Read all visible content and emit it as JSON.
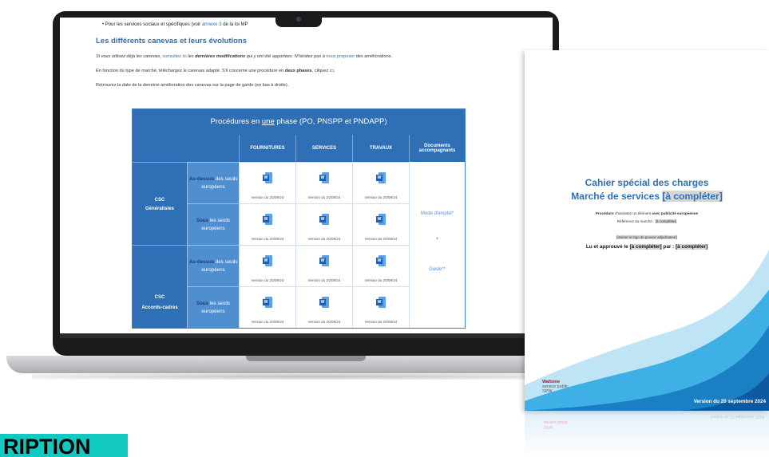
{
  "screen": {
    "bullet": {
      "prefix": "• Pour les services sociaux et spécifiques (voir ",
      "link": "annexe 3",
      "suffix": " de la loi MP"
    },
    "section_title": "Les différents canevas et leurs évolutions",
    "p1": {
      "a": "Si vous utilisez déjà les canevas, ",
      "link1": "consultez ici",
      "b": " les ",
      "bold": "dernières modifications",
      "c": " qui y ont été apportées. N'hésitez pas à ",
      "link2": "nous proposer",
      "d": " des améliorations."
    },
    "p2": {
      "a": "En fonction du type de marché, téléchargez le canevas adapté. S'il concerne une procédure en ",
      "bold": "deux phases",
      "b": ", cliquez ",
      "link": "ici",
      "c": "."
    },
    "p3": "Retrouvez la date de la dernière amélioration des canevas sur la page de garde (en bas à droite).",
    "table": {
      "title_a": "Procédures en ",
      "title_u": "une",
      "title_b": " phase (PO, PNSPP et PNDAPP)",
      "columns": [
        "FOURNITURES",
        "SERVICES",
        "TRAVAUX",
        "Documents accompagnants"
      ],
      "groups": [
        "CSC Généralistes",
        "CSC Accords-cadres"
      ],
      "group_line1": [
        "CSC",
        "CSC"
      ],
      "group_line2": [
        "Généralistes",
        "Accords-cadres"
      ],
      "rows": [
        {
          "strong": "Au-dessus",
          "rest": " des seuils européens"
        },
        {
          "strong": "Sous",
          "rest": " les seuils européens"
        },
        {
          "strong": "Au-dessus",
          "rest": " des seuils européens"
        },
        {
          "strong": "Sous",
          "rest": " les seuils européens"
        }
      ],
      "version_label": "Version du 20/09/24",
      "icon_letter": "W",
      "docs": [
        "Mode d'emploi*",
        "+",
        "Guide**"
      ]
    }
  },
  "document": {
    "title_line1": "Cahier spécial des charges",
    "title_line2_a": "Marché de services ",
    "title_line2_hl": "[à compléter]",
    "procedure_a": "Procédure",
    "procedure_b": " choisissez un élément ",
    "procedure_c": "avec publicité européenne",
    "reference_a": "Référence du marché : ",
    "reference_hl": "[à compléter]",
    "logo_line": "[Insérer le logo du pouvoir adjudicateur]",
    "approved_a": "Lu et approuvé le ",
    "approved_hl1": "[à compléter]",
    "approved_b": " par : ",
    "approved_hl2": "[à compléter]",
    "brand_line1": "Wallonie",
    "brand_line2": "service public",
    "brand_line3": "SPW",
    "version": "Version du 20 septembre 2024"
  },
  "badge": "RIPTION",
  "colors": {
    "primary_blue": "#2e6fb6",
    "light_blue": "#4f8fd0",
    "brand_red": "#b3122b",
    "badge_teal": "#12c9c1"
  }
}
